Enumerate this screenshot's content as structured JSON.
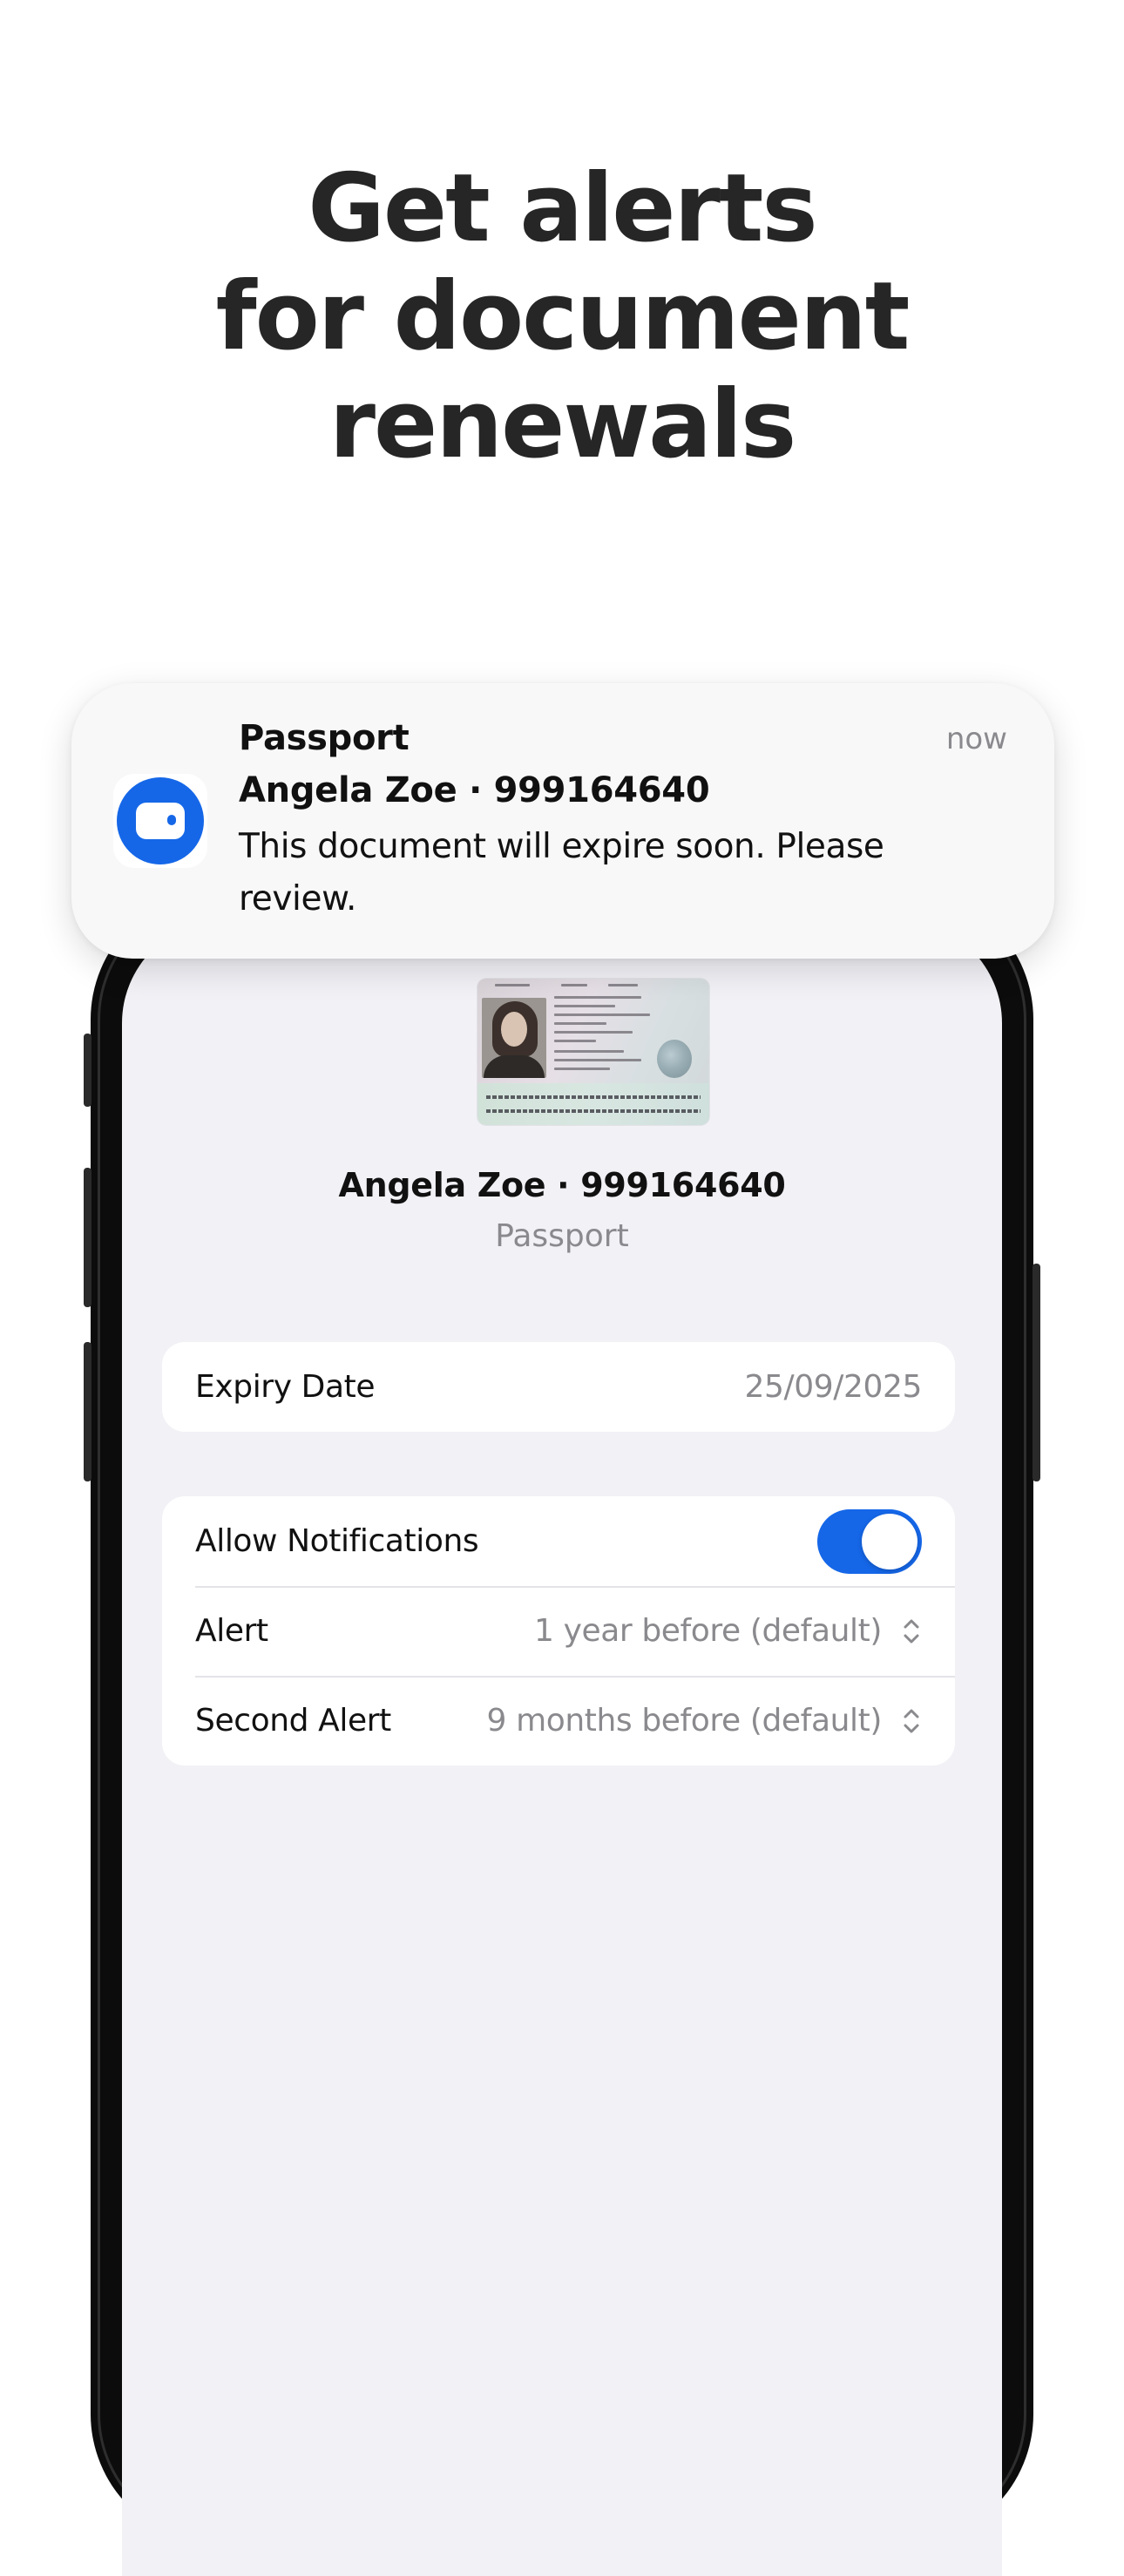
{
  "headline": {
    "line1": "Get alerts",
    "line2": "for document",
    "line3": "renewals"
  },
  "notification": {
    "app_icon": "wallet-icon",
    "title": "Passport",
    "subtitle": "Angela Zoe · 999164640",
    "body": "This document will expire soon. Please review.",
    "time": "now"
  },
  "document": {
    "image": "passport-image",
    "title": "Angela Zoe · 999164640",
    "type": "Passport"
  },
  "expiry": {
    "label": "Expiry Date",
    "value": "25/09/2025"
  },
  "notifications_settings": {
    "allow_label": "Allow Notifications",
    "allow_enabled": true,
    "alert_label": "Alert",
    "alert_value": "1 year before (default)",
    "second_alert_label": "Second Alert",
    "second_alert_value": "9 months before (default)"
  },
  "colors": {
    "accent": "#1567e8",
    "background": "#f1f1f6",
    "secondary_text": "#8a8a8e"
  }
}
